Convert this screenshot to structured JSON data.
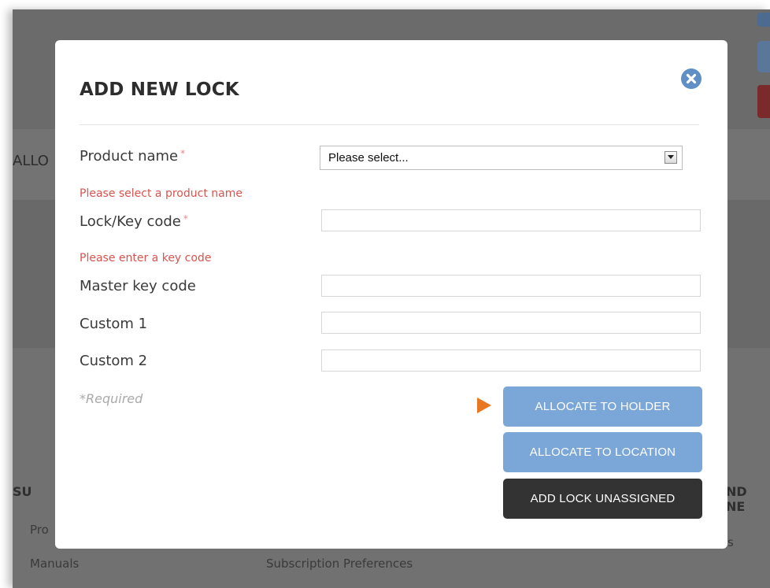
{
  "background": {
    "left_heading": "ALLO",
    "bottom_left_heading": "SU",
    "bottom_right_heading": "ND NE",
    "link_products": "Pro",
    "link_manuals": "Manuals",
    "link_subscription": "Subscription Preferences",
    "right_fragment": "s"
  },
  "modal": {
    "title": "ADD NEW LOCK",
    "close_icon": "close-circle-icon",
    "required_marker": "*",
    "fields": {
      "product_name": {
        "label": "Product name",
        "selected": "Please select...",
        "error": "Please select a product name"
      },
      "lock_key_code": {
        "label": "Lock/Key code",
        "value": "",
        "error": "Please enter a key code"
      },
      "master_key_code": {
        "label": "Master key code",
        "value": ""
      },
      "custom_1": {
        "label": "Custom 1",
        "value": ""
      },
      "custom_2": {
        "label": "Custom 2",
        "value": ""
      }
    },
    "required_note": "*Required",
    "buttons": {
      "allocate_holder": "ALLOCATE TO HOLDER",
      "allocate_location": "ALLOCATE TO LOCATION",
      "add_unassigned": "ADD LOCK UNASSIGNED"
    }
  },
  "colors": {
    "primary_button": "#7aa6d8",
    "dark_button": "#333333",
    "error_text": "#d9534f",
    "pointer_arrow": "#e87722"
  }
}
